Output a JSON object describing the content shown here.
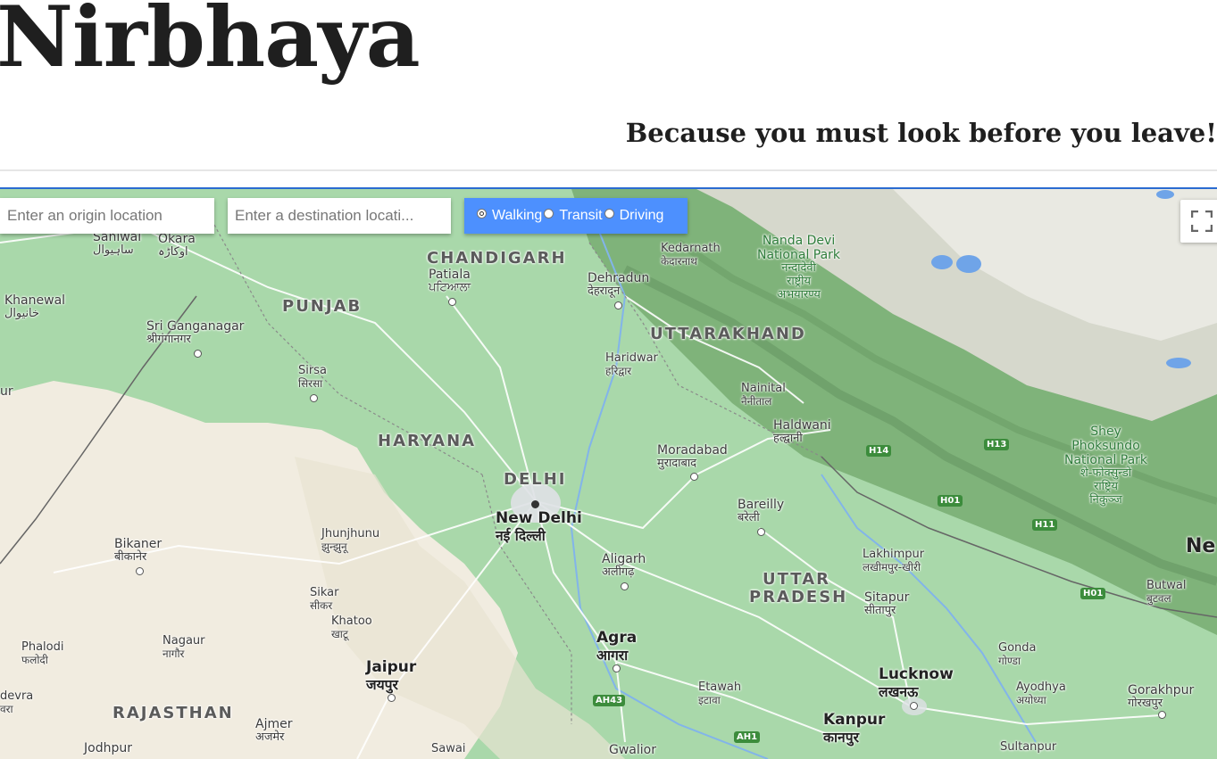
{
  "header": {
    "title": "Nirbhaya",
    "tagline": "Because you must look before you leave!"
  },
  "controls": {
    "origin_placeholder": "Enter an origin location",
    "destination_placeholder": "Enter a destination locati...",
    "modes": [
      {
        "label": "Walking",
        "checked": true
      },
      {
        "label": "Transit",
        "checked": false
      },
      {
        "label": "Driving",
        "checked": false
      }
    ],
    "fullscreen_icon": "fullscreen-icon"
  },
  "map": {
    "states": {
      "punjab": "PUNJAB",
      "haryana": "HARYANA",
      "delhi": "DELHI",
      "uttarakhand": "UTTARAKHAND",
      "uttar_pradesh_1": "UTTAR",
      "uttar_pradesh_2": "PRADESH",
      "rajasthan": "RAJASTHAN",
      "chandigarh": "CHANDIGARH"
    },
    "cities": {
      "sahiwal": "Sahiwal",
      "sahiwal_local": "ساہیوال",
      "okara": "Okara",
      "okara_local": "اوکاڑہ",
      "khanewal": "Khanewal",
      "khanewal_local": "خانیوال",
      "patiala": "Patiala",
      "patiala_local": "ਪਟਿਆਲਾ",
      "dehradun": "Dehradun",
      "dehradun_local": "देहरादून",
      "kedarnath": "Kedarnath",
      "kedarnath_local": "केदारनाथ",
      "sri_ganganagar": "Sri Ganganagar",
      "sri_ganganagar_local": "श्रीगंगानगर",
      "haridwar": "Haridwar",
      "haridwar_local": "हरिद्वार",
      "sirsa": "Sirsa",
      "sirsa_local": "सिरसा",
      "nainital": "Nainital",
      "nainital_local": "नैनीताल",
      "haldwani": "Haldwani",
      "haldwani_local": "हल्द्वानी",
      "moradabad": "Moradabad",
      "moradabad_local": "मुरादाबाद",
      "new_delhi": "New Delhi",
      "new_delhi_local": "नई दिल्ली",
      "bareilly": "Bareilly",
      "bareilly_local": "बरेली",
      "bikaner": "Bikaner",
      "bikaner_local": "बीकानेर",
      "jhunjhunu": "Jhunjhunu",
      "jhunjhunu_local": "झुन्झुनू",
      "aligarh": "Aligarh",
      "aligarh_local": "अलीगढ़",
      "lakhimpur": "Lakhimpur",
      "lakhimpur_local": "लखीमपुर-खीरी",
      "sikar": "Sikar",
      "sikar_local": "सीकर",
      "khatoo": "Khatoo",
      "khatoo_local": "खाटू",
      "sitapur": "Sitapur",
      "sitapur_local": "सीतापुर",
      "butwal": "Butwal",
      "butwal_local": "बुटवल",
      "phalodi": "Phalodi",
      "phalodi_local": "फलोदी",
      "nagaur": "Nagaur",
      "nagaur_local": "नागौर",
      "agra": "Agra",
      "agra_local": "आगरा",
      "gonda": "Gonda",
      "gonda_local": "गोण्डा",
      "jaipur": "Jaipur",
      "jaipur_local": "जयपुर",
      "lucknow": "Lucknow",
      "lucknow_local": "लखनऊ",
      "etawah": "Etawah",
      "etawah_local": "इटावा",
      "ayodhya": "Ayodhya",
      "ayodhya_local": "अयोध्या",
      "gorakhpur": "Gorakhpur",
      "gorakhpur_local": "गोरखपुर",
      "devra": "devra",
      "devra_local": "वरा",
      "ajmer": "Ajmer",
      "ajmer_local": "अजमेर",
      "kanpur": "Kanpur",
      "kanpur_local": "कानपुर",
      "jodhpur": "Jodhpur",
      "sawai": "Sawai",
      "gwalior": "Gwalior",
      "sultanpur": "Sultanpur",
      "ne": "Ne",
      "ur": "ur"
    },
    "parks": {
      "nanda_devi_1": "Nanda Devi",
      "nanda_devi_2": "National Park",
      "nanda_devi_l1": "नन्दादेवी",
      "nanda_devi_l2": "राष्ट्रीय",
      "nanda_devi_l3": "अभयारण्य",
      "shey_1": "Shey",
      "shey_2": "Phoksundo",
      "shey_3": "National Park",
      "shey_l1": "शे-फोक्सुन्डो",
      "shey_l2": "राष्ट्रिय",
      "shey_l3": "निकुञ्ज"
    },
    "highways": {
      "h14": "H14",
      "h13": "H13",
      "h01a": "H01",
      "h01b": "H01",
      "h11": "H11",
      "ah43": "AH43",
      "ah1": "AH1"
    },
    "colors": {
      "plains": "#a9d8aa",
      "desert": "#f1ece0",
      "mountains": "#7fb37a",
      "highlands": "#d6d8cc",
      "water": "#6fa4e8",
      "accent_blue": "#4d90fe"
    }
  }
}
